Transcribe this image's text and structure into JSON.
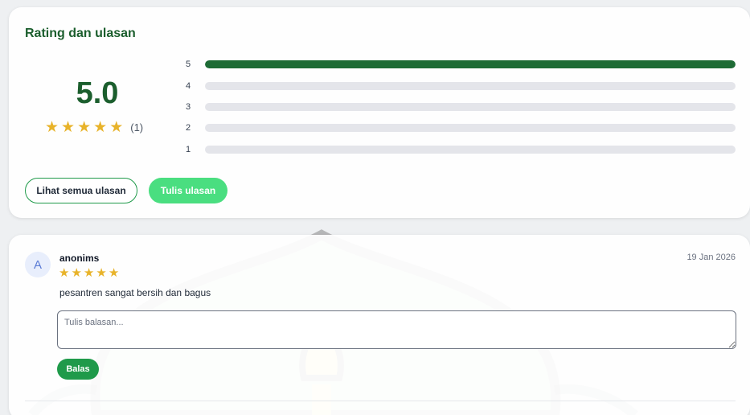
{
  "rating_card": {
    "title": "Rating dan ulasan",
    "average": "5.0",
    "stars": 5,
    "count_text": "(1)",
    "distribution": [
      {
        "label": "5",
        "fraction": 1.0
      },
      {
        "label": "4",
        "fraction": 0.0
      },
      {
        "label": "3",
        "fraction": 0.0
      },
      {
        "label": "2",
        "fraction": 0.0
      },
      {
        "label": "1",
        "fraction": 0.0
      }
    ],
    "see_all_label": "Lihat semua ulasan",
    "write_label": "Tulis ulasan"
  },
  "review": {
    "avatar_initial": "A",
    "author": "anonims",
    "date": "19 Jan 2026",
    "stars": 5,
    "text": "pesantren sangat bersih dan bagus",
    "reply_placeholder": "Tulis balasan...",
    "reply_value": "",
    "reply_button": "Balas"
  },
  "colors": {
    "brand_dark": "#1b5e2d",
    "bar_fill": "#1e6b35",
    "bar_track": "#e4e5ea",
    "star": "#e8b32a",
    "primary_button": "#4ade80",
    "reply_button": "#1f9a4a"
  },
  "icons": {
    "star": "star-icon"
  }
}
